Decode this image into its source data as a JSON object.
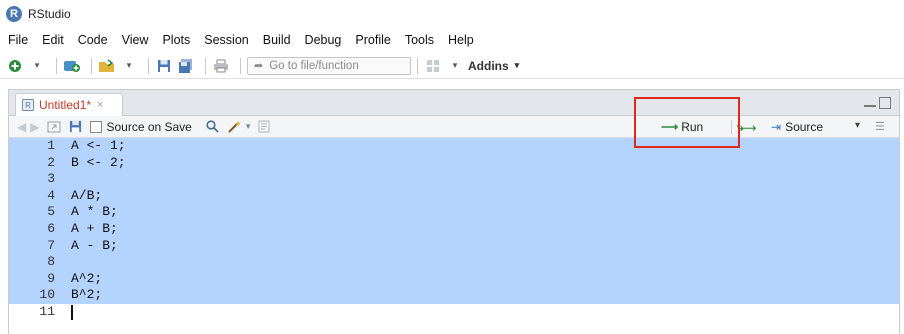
{
  "window": {
    "title": "RStudio"
  },
  "menu": [
    "File",
    "Edit",
    "Code",
    "View",
    "Plots",
    "Session",
    "Build",
    "Debug",
    "Profile",
    "Tools",
    "Help"
  ],
  "toolbar": {
    "goto_placeholder": "Go to file/function",
    "addins_label": "Addins"
  },
  "editor_tab": {
    "label": "Untitled1*",
    "close_glyph": "×"
  },
  "editor_toolbar": {
    "source_on_save_label": "Source on Save",
    "run_label": "Run",
    "source_label": "Source"
  },
  "code_lines": [
    {
      "num": "1",
      "text": "A <- 1;",
      "selected": true
    },
    {
      "num": "2",
      "text": "B <- 2;",
      "selected": true
    },
    {
      "num": "3",
      "text": "",
      "selected": true
    },
    {
      "num": "4",
      "text": "A/B;",
      "selected": true
    },
    {
      "num": "5",
      "text": "A * B;",
      "selected": true
    },
    {
      "num": "6",
      "text": "A + B;",
      "selected": true
    },
    {
      "num": "7",
      "text": "A - B;",
      "selected": true
    },
    {
      "num": "8",
      "text": "",
      "selected": true
    },
    {
      "num": "9",
      "text": "A^2;",
      "selected": true
    },
    {
      "num": "10",
      "text": "B^2;",
      "selected": true
    },
    {
      "num": "11",
      "text": "",
      "selected": false
    }
  ],
  "colors": {
    "selection": "#b5d3ff",
    "highlight_box": "#e0281e",
    "run_arrow": "#2e8b3e",
    "tab_label": "#c0392b"
  }
}
